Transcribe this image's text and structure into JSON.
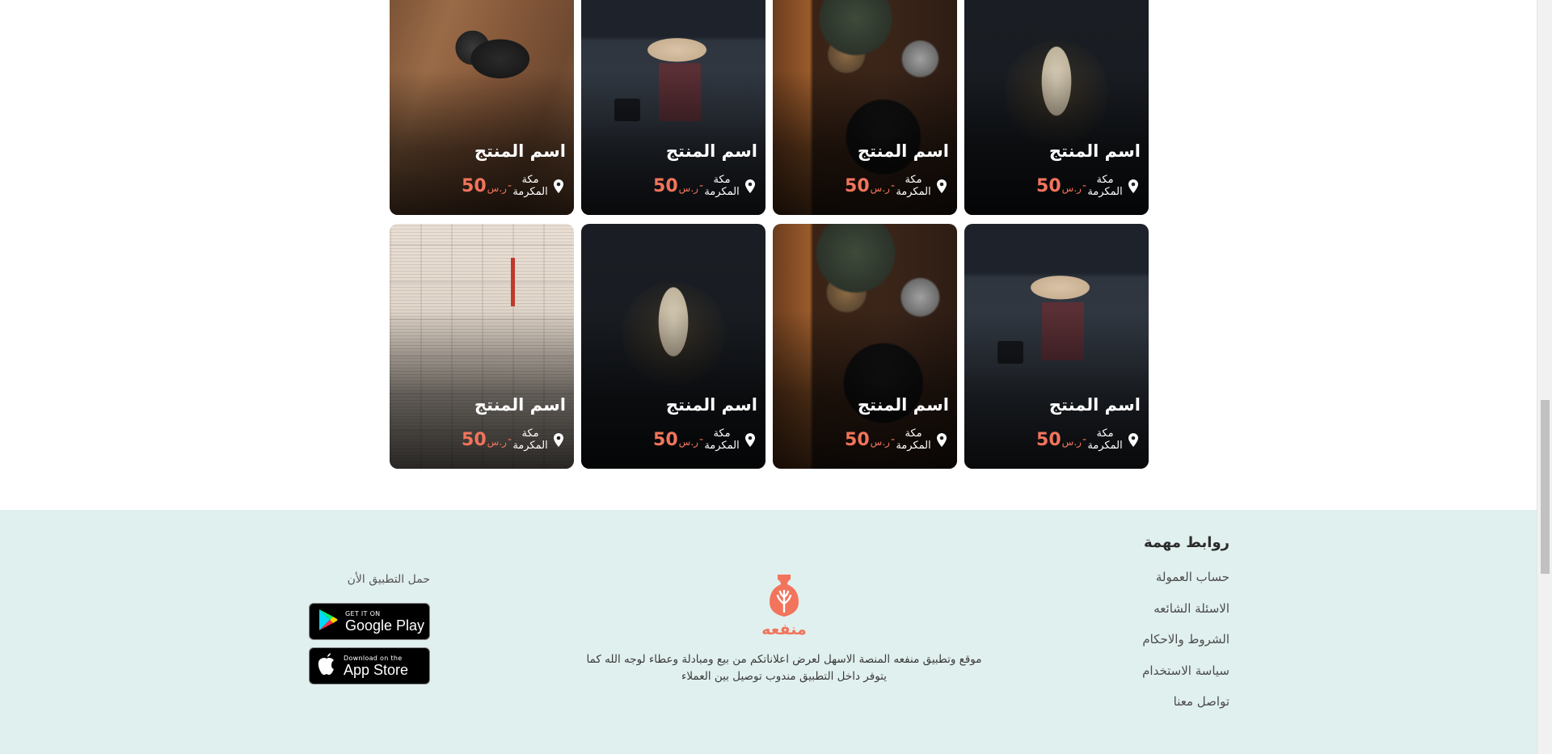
{
  "products": [
    {
      "name": "اسم المنتج",
      "city": "مكة المكرمة",
      "price": "50",
      "currency": "ر.س",
      "image": "camera"
    },
    {
      "name": "اسم المنتج",
      "city": "مكة المكرمة",
      "price": "50",
      "currency": "ر.س",
      "image": "desk"
    },
    {
      "name": "اسم المنتج",
      "city": "مكة المكرمة",
      "price": "50",
      "currency": "ر.س",
      "image": "spice"
    },
    {
      "name": "اسم المنتج",
      "city": "مكة المكرمة",
      "price": "50",
      "currency": "ر.س",
      "image": "cable"
    },
    {
      "name": "اسم المنتج",
      "city": "مكة المكرمة",
      "price": "50",
      "currency": "ر.س",
      "image": "books"
    },
    {
      "name": "اسم المنتج",
      "city": "مكة المكرمة",
      "price": "50",
      "currency": "ر.س",
      "image": "cable"
    },
    {
      "name": "اسم المنتج",
      "city": "مكة المكرمة",
      "price": "50",
      "currency": "ر.س",
      "image": "spice"
    },
    {
      "name": "اسم المنتج",
      "city": "مكة المكرمة",
      "price": "50",
      "currency": "ر.س",
      "image": "desk"
    }
  ],
  "footer": {
    "links_title": "روابط مهمة",
    "links": [
      "حساب العمولة",
      "الاسئلة الشائعه",
      "الشروط والاحكام",
      "سياسة الاستخدام",
      "تواصل معنا"
    ],
    "brand_name": "منفعه",
    "brand_description": "موقع وتطبيق منفعه المنصة الاسهل لعرض اعلاناتكم من بيع ومبادلة وعطاء لوجه الله كما يتوفر داخل التطبيق مندوب توصيل بين العملاء",
    "download_title": "حمل التطبيق الأن",
    "google_play": {
      "small": "GET IT ON",
      "big": "Google Play"
    },
    "app_store": {
      "small": "Download on the",
      "big": "App Store"
    }
  },
  "colors": {
    "accent": "#f2745c",
    "footer_bg": "#e0f0ee"
  },
  "icons": {
    "location": "map-pin-icon",
    "brand": "vase-leaf-logo",
    "google_play": "play-triangle-icon",
    "apple": "apple-icon"
  }
}
